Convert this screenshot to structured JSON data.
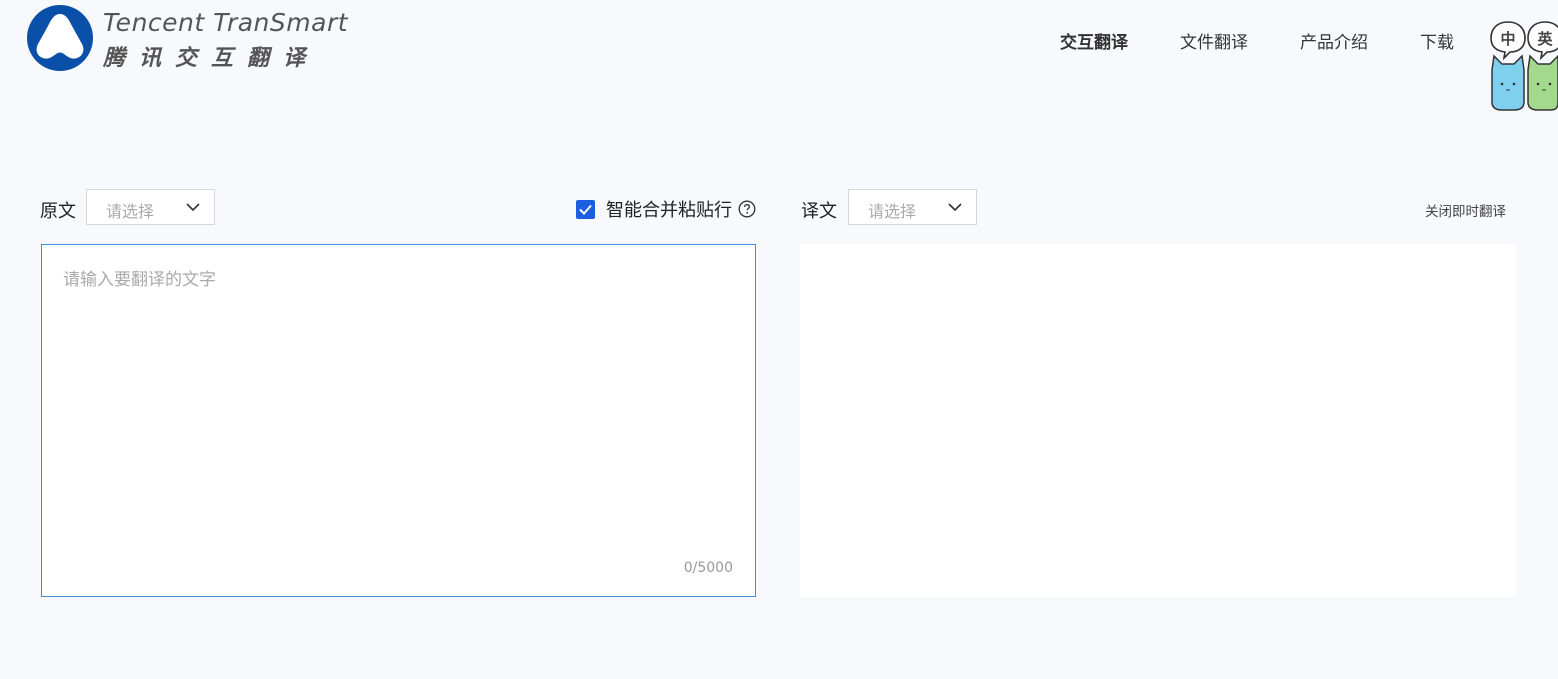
{
  "brand": {
    "name_en": "Tencent TranSmart",
    "name_cn": "腾讯交互翻译",
    "logo_icon": "tencent-transmart-logo",
    "accent": "#0a4fa8"
  },
  "nav": {
    "items": [
      {
        "label": "交互翻译",
        "active": true
      },
      {
        "label": "文件翻译",
        "active": false
      },
      {
        "label": "产品介绍",
        "active": false
      },
      {
        "label": "下载",
        "active": false
      }
    ],
    "mascot_bubbles": [
      "中",
      "英"
    ]
  },
  "source": {
    "label": "原文",
    "language_select_placeholder": "请选择",
    "input_placeholder": "请输入要翻译的文字",
    "counter": "0/5000",
    "border_color": "#3d8fd6"
  },
  "merge_paste": {
    "label": "智能合并粘贴行",
    "checked": true,
    "check_color": "#1b5fe0",
    "help_icon": "question-circle-icon"
  },
  "target": {
    "label": "译文",
    "language_select_placeholder": "请选择",
    "close_instant_label": "关闭即时翻译"
  }
}
